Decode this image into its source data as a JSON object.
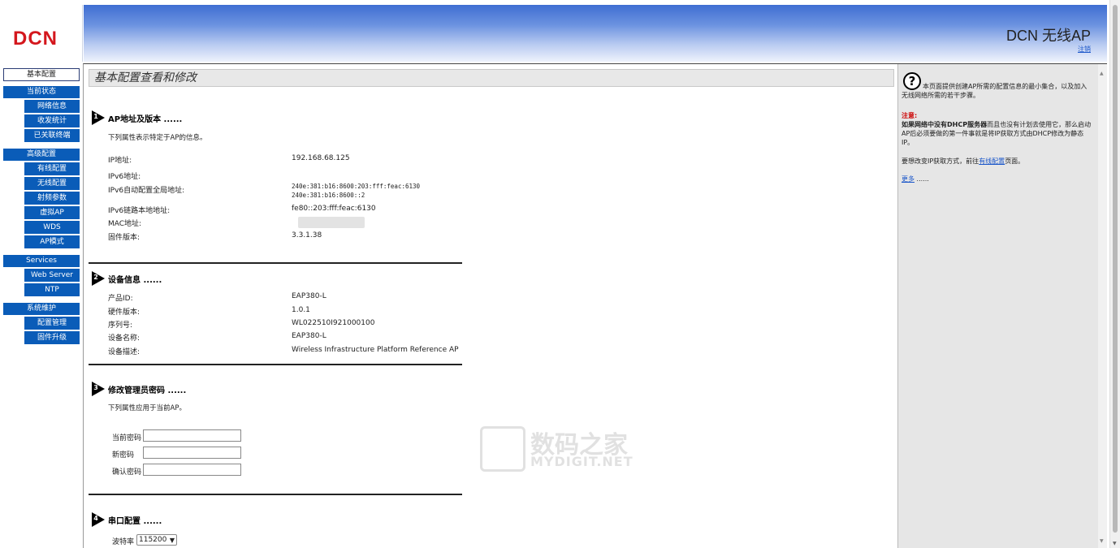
{
  "header": {
    "logo": "DCN",
    "title": "DCN 无线AP",
    "logout": "注销"
  },
  "sidebar": {
    "top": "基本配置",
    "groups": [
      {
        "label": "当前状态",
        "items": [
          "网络信息",
          "收发统计",
          "已关联终端"
        ]
      },
      {
        "label": "高级配置",
        "items": [
          "有线配置",
          "无线配置",
          "射频参数",
          "虚拟AP",
          "WDS",
          "AP模式"
        ]
      },
      {
        "label": "Services",
        "items": [
          "Web Server",
          "NTP"
        ]
      },
      {
        "label": "系统维护",
        "items": [
          "配置管理",
          "固件升级"
        ]
      }
    ]
  },
  "main": {
    "heading": "基本配置查看和修改",
    "sections": {
      "s1": {
        "num": "1",
        "title": "AP地址及版本 ......",
        "desc": "下列属性表示特定于AP的信息。",
        "rows": [
          {
            "label": "IP地址:",
            "value": "192.168.68.125"
          },
          {
            "label": "IPv6地址:",
            "value": ""
          },
          {
            "label": "IPv6自动配置全局地址:",
            "value": "240e:381:b16:8600:203:fff:feac:6130",
            "value2": "240e:381:b16:8600::2"
          },
          {
            "label": "IPv6链路本地地址:",
            "value": "fe80::203:fff:feac:6130"
          },
          {
            "label": "MAC地址:",
            "value": ""
          },
          {
            "label": "固件版本:",
            "value": "3.3.1.38"
          }
        ]
      },
      "s2": {
        "num": "2",
        "title": "设备信息 ......",
        "rows": [
          {
            "label": "产品ID:",
            "value": "EAP380-L"
          },
          {
            "label": "硬件版本:",
            "value": "1.0.1"
          },
          {
            "label": "序列号:",
            "value": "WL022510I921000100"
          },
          {
            "label": "设备名称:",
            "value": "EAP380-L"
          },
          {
            "label": "设备描述:",
            "value": "Wireless Infrastructure Platform Reference AP"
          }
        ]
      },
      "s3": {
        "num": "3",
        "title": "修改管理员密码 ......",
        "desc": "下列属性应用于当前AP。",
        "current_pw_label": "当前密码",
        "new_pw_label": "新密码",
        "confirm_pw_label": "确认密码",
        "current_pw_value": "",
        "new_pw_value": "",
        "confirm_pw_value": ""
      },
      "s4": {
        "num": "4",
        "title": "串口配置 ......",
        "baud_label": "波特率",
        "baud_value": "115200"
      }
    }
  },
  "watermark": {
    "cn": "数码之家",
    "en": "MYDIGIT.NET"
  },
  "help": {
    "icon": "?",
    "intro": "本页面提供创建AP所需的配置信息的最小集合，以及加入无线网络所需的若干步骤。",
    "note_title": "注意:",
    "note_bold": "如果网络中没有DHCP服务器",
    "note_rest": "而且也没有计划去使用它，那么启动AP后必须要做的第一件事就是将IP获取方式由DHCP修改为静态IP。",
    "change_pre": "要想改变IP获取方式，前往",
    "change_link": "有线配置",
    "change_post": "页面。",
    "more_link": "更多",
    "more_dots": "......"
  }
}
